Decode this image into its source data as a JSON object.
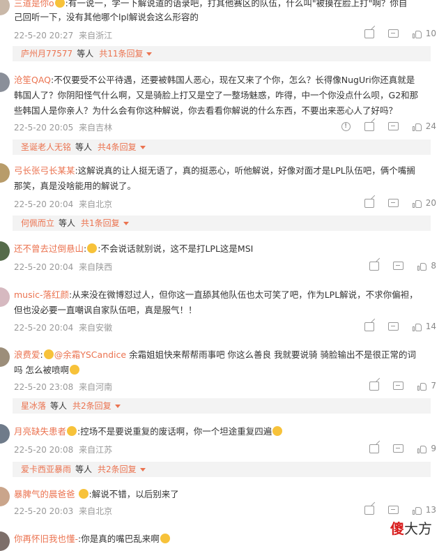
{
  "comments": [
    {
      "user": "三道是你o",
      "lines": [
        "有一说一，学一下解说道的语录吧，打其他赛区的队伍，什么叫\"被摸在脸上打\"啊？你自",
        "己回听一下，没有其他哪个lpl解说会这么形容的"
      ],
      "date": "22-5-20 20:27",
      "location": "来自浙江",
      "likes": "10",
      "replies": {
        "name": "庐州月77577",
        "etc": "等人",
        "count": "共11条回复"
      }
    },
    {
      "user": "沧笙QAQ",
      "lines": [
        "不仅要受不公平待遇，还要被韩国人恶心，现在又来了个你，怎么？长得像NugUri你还真就是",
        "韩国人了？你阴阳怪气什么啊，又是骑脸上打又是空了一整场魅惑，咋得，中一个你没点什么呗，G2和那",
        "些韩国人是你亲人？为什么会有你这种解说，你去看看你解说的什么东西，不要出来恶心人了好吗？"
      ],
      "date": "22-5-20 20:05",
      "location": "来自吉林",
      "likes": "24",
      "replies": {
        "name": "圣诞老人无铭",
        "etc": "等人",
        "count": "共4条回复"
      }
    },
    {
      "user": "弓长张弓长某某",
      "lines": [
        "这解说真的让人挺无语了，真的挺恶心，听他解说，好像对面才是LPL队伍吧，俩个嘴搁",
        "那笑，真是没啥能用的解说了。"
      ],
      "date": "22-5-20 20:04",
      "location": "来自北京",
      "likes": "20",
      "replies": {
        "name": "何佩而立",
        "etc": "等人",
        "count": "共1条回复"
      }
    },
    {
      "user": "还不曾去过倒悬山",
      "lines": [
        "不会说话就别说，这不是打LPL这是MSI"
      ],
      "date": "22-5-20 20:04",
      "location": "来自陕西",
      "likes": "8"
    },
    {
      "user": "music-落红颜",
      "lines": [
        "从来没在微博怼过人，但你这一直舔其他队伍也太可笑了吧，作为LPL解说，不求你偏袒，",
        "但也没必要一直嘲讽自家队伍吧，真是服气！！"
      ],
      "date": "22-5-20 20:04",
      "location": "来自安徽",
      "likes": "14"
    },
    {
      "user": "浪费爱",
      "mention": "@余霜YSCandice",
      "lines": [
        "余霜姐姐快来帮帮雨事吧 你这么善良 我就要说骑 骑脸输出不是很正常的词",
        "吗 怎么被喷啊"
      ],
      "date": "22-5-20 23:08",
      "location": "来自河南",
      "likes": "7",
      "replies": {
        "name": "星冰落",
        "etc": "等人",
        "count": "共2条回复"
      }
    },
    {
      "user": "月亮缺失患者",
      "lines": [
        "控场不是要说重复的废话啊，你一个坦途重复四遍"
      ],
      "date": "22-5-20 20:08",
      "location": "来自江苏",
      "likes": "9",
      "replies": {
        "name": "爱卡西亚暴雨",
        "etc": "等人",
        "count": "共2条回复"
      }
    },
    {
      "user": "暴脾气的晨爸爸",
      "lines": [
        "解说不错，以后别来了"
      ],
      "date": "22-5-20 20:03",
      "location": "来自北京",
      "likes": "13"
    },
    {
      "user": "你再怀旧我也懂-",
      "lines": [
        "你是真的嘴巴乱来啊"
      ]
    }
  ],
  "watermark": {
    "part1": "傻",
    "part2": "大方"
  }
}
